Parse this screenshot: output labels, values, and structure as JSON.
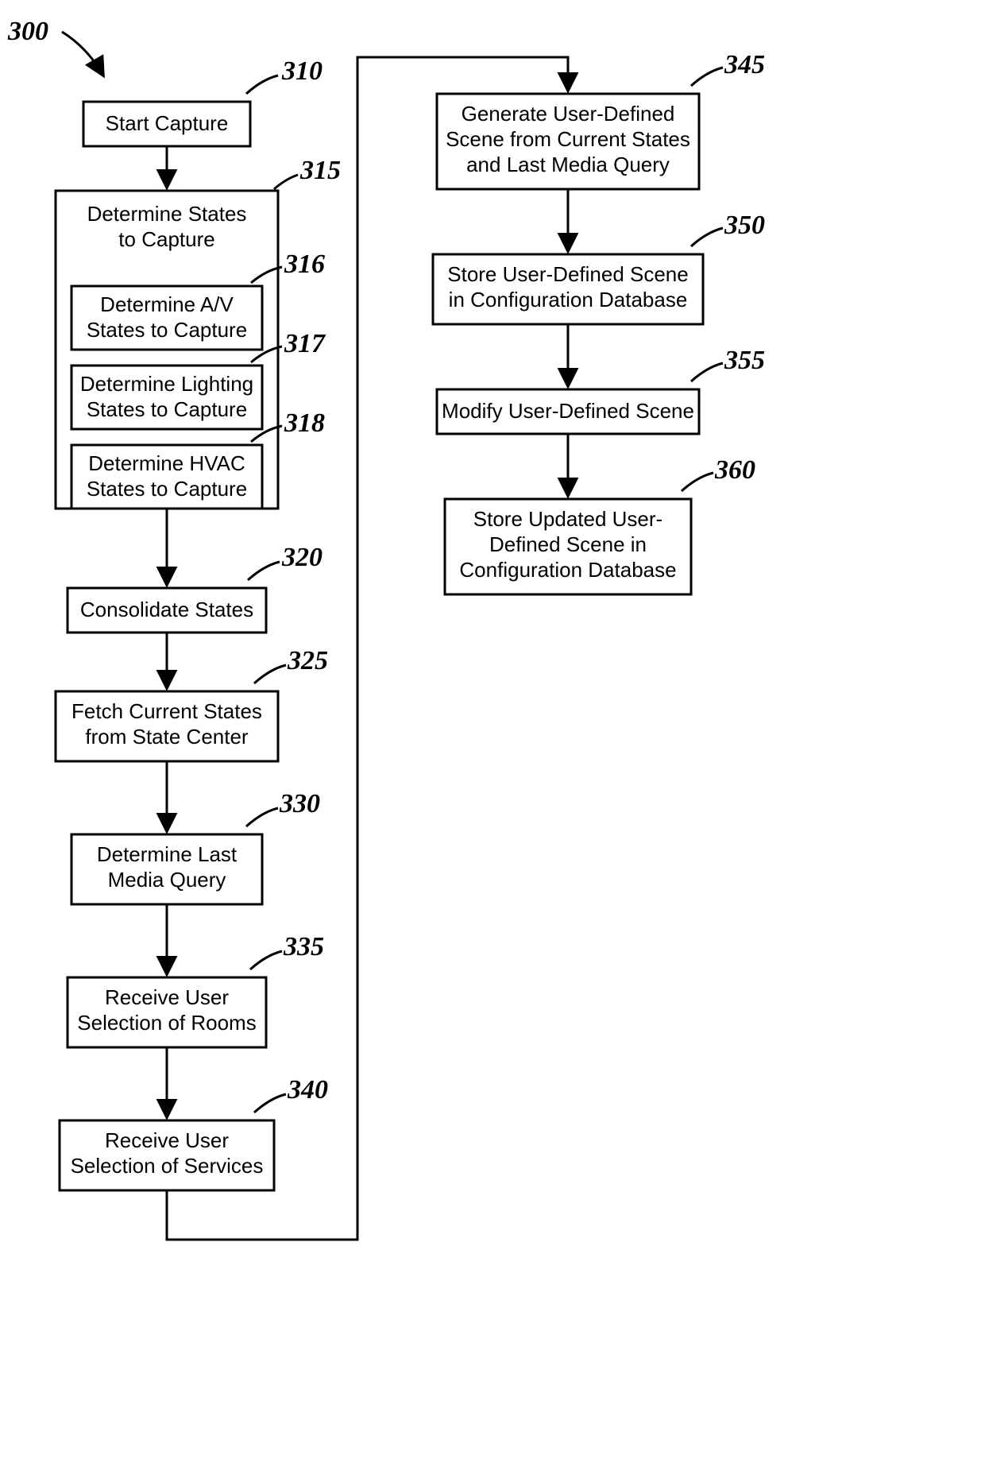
{
  "figureRef": "300",
  "nodes": {
    "n310": {
      "ref": "310",
      "lines": [
        "Start Capture"
      ]
    },
    "n315": {
      "ref": "315",
      "lines": [
        "Determine States",
        "to Capture"
      ]
    },
    "n316": {
      "ref": "316",
      "lines": [
        "Determine A/V",
        "States to Capture"
      ]
    },
    "n317": {
      "ref": "317",
      "lines": [
        "Determine Lighting",
        "States to Capture"
      ]
    },
    "n318": {
      "ref": "318",
      "lines": [
        "Determine HVAC",
        "States to Capture"
      ]
    },
    "n320": {
      "ref": "320",
      "lines": [
        "Consolidate States"
      ]
    },
    "n325": {
      "ref": "325",
      "lines": [
        "Fetch Current States",
        "from State Center"
      ]
    },
    "n330": {
      "ref": "330",
      "lines": [
        "Determine Last",
        "Media Query"
      ]
    },
    "n335": {
      "ref": "335",
      "lines": [
        "Receive User",
        "Selection of Rooms"
      ]
    },
    "n340": {
      "ref": "340",
      "lines": [
        "Receive User",
        "Selection of Services"
      ]
    },
    "n345": {
      "ref": "345",
      "lines": [
        "Generate User-Defined",
        "Scene from Current States",
        "and Last Media Query"
      ]
    },
    "n350": {
      "ref": "350",
      "lines": [
        "Store User-Defined Scene",
        "in Configuration Database"
      ]
    },
    "n355": {
      "ref": "355",
      "lines": [
        "Modify User-Defined Scene"
      ]
    },
    "n360": {
      "ref": "360",
      "lines": [
        "Store Updated User-",
        "Defined Scene in",
        "Configuration Database"
      ]
    }
  }
}
